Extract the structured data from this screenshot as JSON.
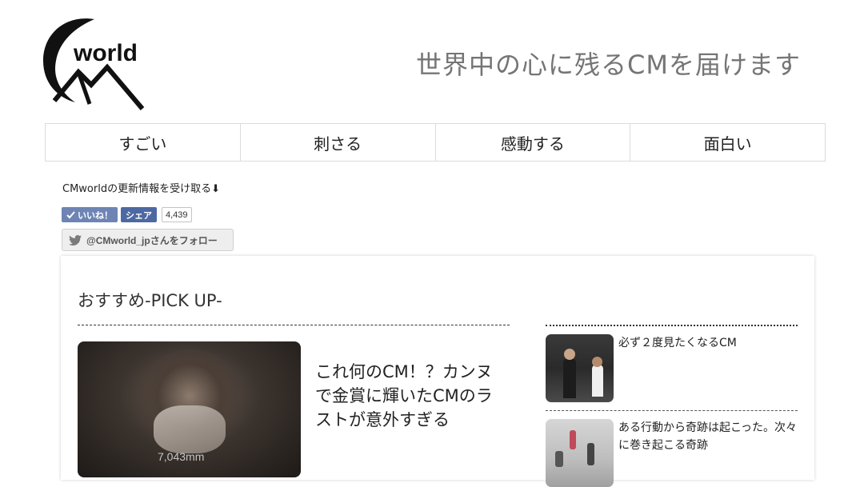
{
  "header": {
    "logo_text": "world",
    "tagline": "世界中の心に残るCMを届けます"
  },
  "nav": {
    "items": [
      {
        "label": "すごい"
      },
      {
        "label": "刺さる"
      },
      {
        "label": "感動する"
      },
      {
        "label": "面白い"
      }
    ]
  },
  "subscribe": {
    "text": "CMworldの更新情報を受け取る⬇"
  },
  "social": {
    "like_label": "いいね！",
    "share_label": "シェア",
    "count": "4,439",
    "twitter_label": "@CMworld_jpさんをフォロー"
  },
  "pickup": {
    "title": "おすすめ-PICK UP-",
    "main_article": {
      "title": "これ何のCM！？カンヌで金賞に輝いたCMのラストが意外すぎる",
      "thumb_caption": "7,043mm"
    },
    "side_articles": [
      {
        "title": "必ず２度見たくなるCM"
      },
      {
        "title": "ある行動から奇跡は起こった。次々に巻き起こる奇跡"
      }
    ]
  },
  "colors": {
    "facebook": "#4e69a2",
    "tagline": "#757575",
    "border": "#dcdcdc"
  }
}
